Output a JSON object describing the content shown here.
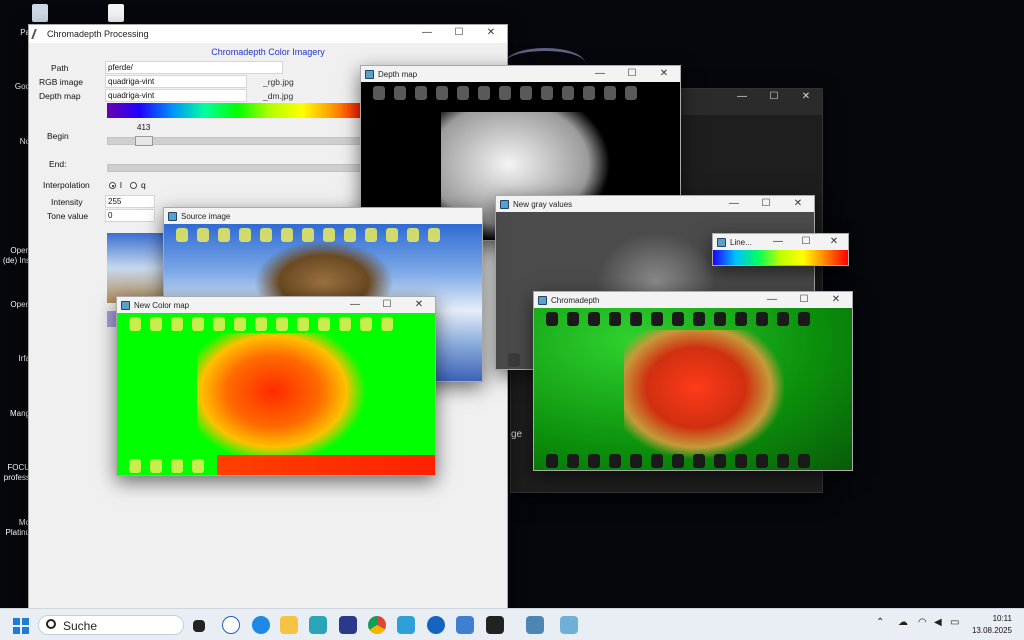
{
  "desktop": {
    "left_labels": [
      "Pa",
      "Goo",
      "No",
      "Open",
      "(de) Ins",
      "Open",
      "Irfa",
      "Mang",
      "FOCU",
      "profess",
      "Mo",
      "Platinu"
    ],
    "background_fragment": "ge"
  },
  "main_window": {
    "title": "Chromadepth Processing",
    "heading": "Chromadepth Color Imagery",
    "path_label": "Path",
    "path_value": "pferde/",
    "rgb_label": "RGB image",
    "rgb_value": "quadriga-vint",
    "rgb_suffix": "_rgb.jpg",
    "depth_label": "Depth map",
    "depth_value": "quadriga-vint",
    "depth_suffix": "_dm.jpg",
    "begin_label": "Begin",
    "begin_value": "413",
    "end_label": "End:",
    "interp_label": "Interpolation",
    "interp_options": [
      "l",
      "q"
    ],
    "interp_selected": "l",
    "intensity_label": "Intensity",
    "intensity_value": "255",
    "tone_label": "Tone value",
    "tone_value": "0"
  },
  "windows": {
    "depth_map": "Depth map",
    "new_gray": "New gray values",
    "line": "Line...",
    "chromadepth": "Chromadepth",
    "source_image": "Source image",
    "new_color_map": "New Color map"
  },
  "window_controls": {
    "minimize": "—",
    "maximize": "☐",
    "close": "✕"
  },
  "taskbar": {
    "search_placeholder": "Suche",
    "time": "10:11",
    "date": "13.08.2025"
  },
  "colors": {
    "gradient_start": "#6a00b0",
    "gradient_end": "#ff0000",
    "chroma_green": "#00ff00"
  }
}
